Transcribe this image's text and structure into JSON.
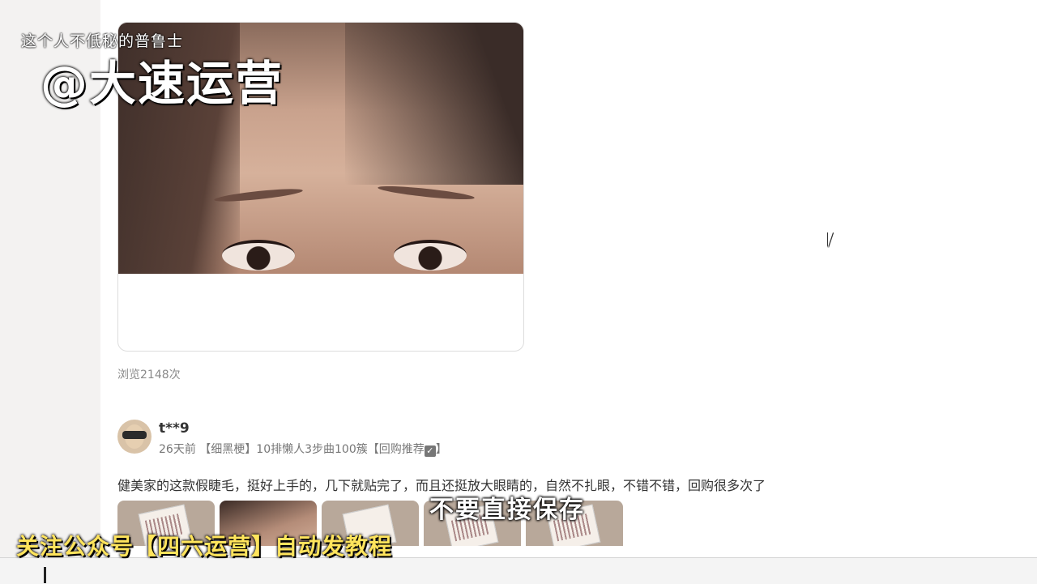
{
  "overlay": {
    "top_caption": "这个人不低秘的普鲁士",
    "watermark": "@大速运营",
    "subtitle": "不要直接保存",
    "banner": "关注公众号【四六运营】自动发教程"
  },
  "post": {
    "views": "浏览2148次"
  },
  "review": {
    "username": "t**9",
    "time": "26天前",
    "spec": "【细黑梗】10排懒人3步曲100簇【回购推荐",
    "spec_end": "】",
    "check_icon": "check-box-icon",
    "text": "健美家的这款假睫毛，挺好上手的，几下就贴完了，而且还挺放大眼睛的，自然不扎眼，不错不错，回购很多次了"
  },
  "colors": {
    "banner": "#ffe45c",
    "text": "#333333",
    "meta": "#777777"
  }
}
